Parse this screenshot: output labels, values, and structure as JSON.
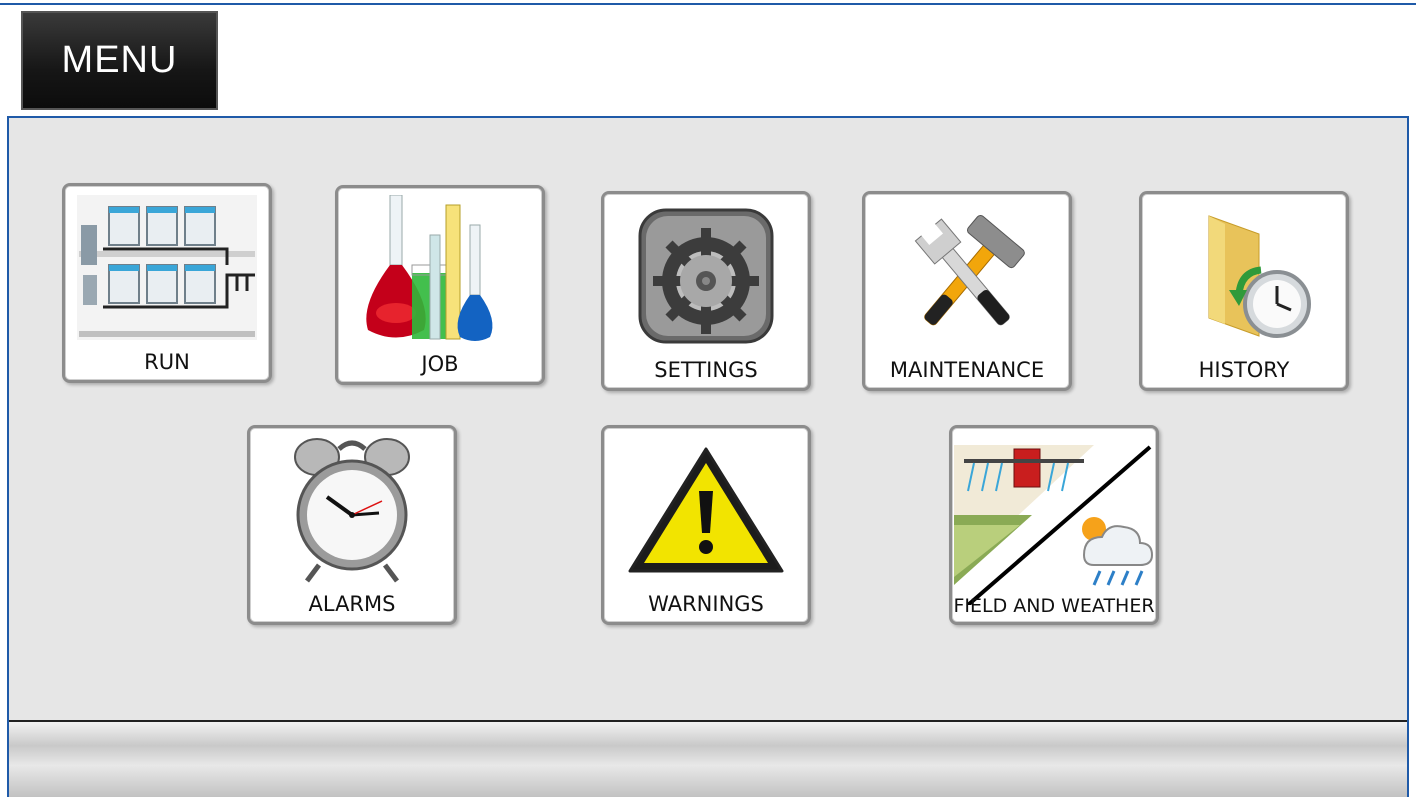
{
  "header": {
    "menu_label": "MENU"
  },
  "tiles": [
    {
      "label": "RUN",
      "icon": "tank-system-icon"
    },
    {
      "label": "JOB",
      "icon": "lab-flasks-icon"
    },
    {
      "label": "SETTINGS",
      "icon": "gear-icon"
    },
    {
      "label": "MAINTENANCE",
      "icon": "hammer-wrench-icon"
    },
    {
      "label": "HISTORY",
      "icon": "folder-clock-icon"
    },
    {
      "label": "ALARMS",
      "icon": "alarm-clock-icon"
    },
    {
      "label": "WARNINGS",
      "icon": "warning-icon"
    },
    {
      "label": "FIELD AND WEATHER",
      "icon": "field-weather-icon"
    }
  ],
  "colors": {
    "frame": "#1f5aa8",
    "panel": "#e6e6e6",
    "warning": "#f2e400"
  }
}
